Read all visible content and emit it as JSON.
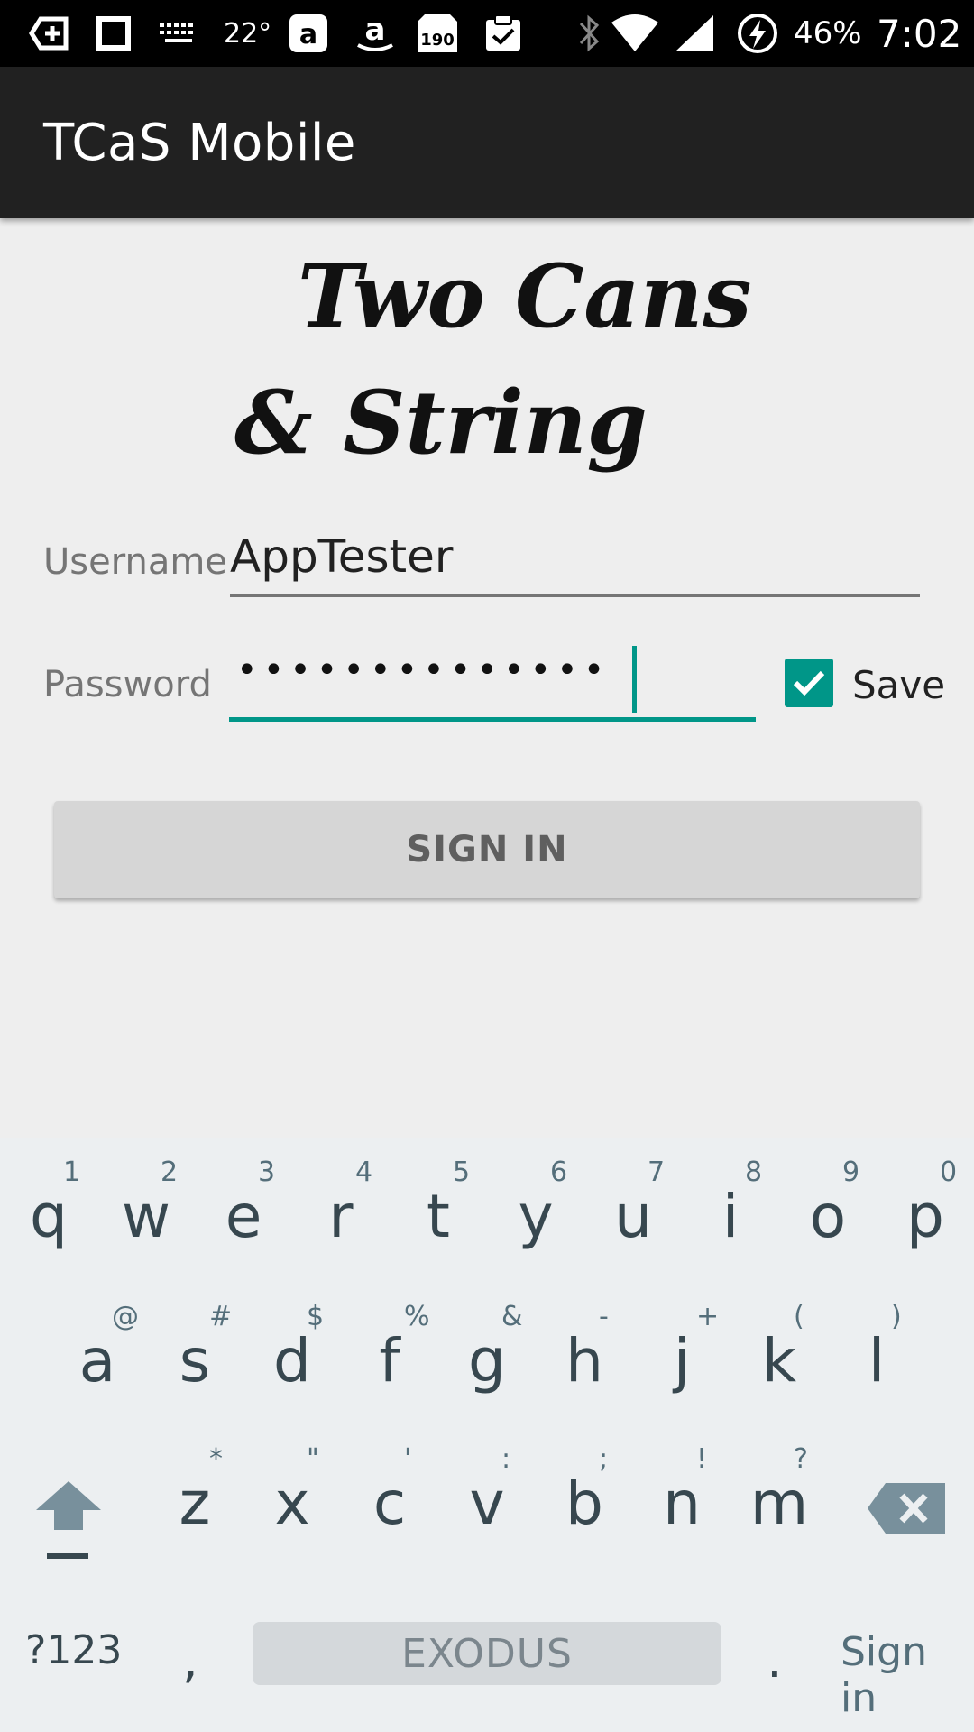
{
  "status_bar": {
    "temperature": "22°",
    "badge_count": "190",
    "battery_percent": "46%",
    "time": "7:02",
    "icons": [
      "add-box-icon",
      "square-icon",
      "keyboard-icon",
      "amazon-a-icon",
      "amazon-smile-icon",
      "mail-badge-icon",
      "clipboard-check-icon",
      "bluetooth-icon",
      "wifi-icon",
      "signal-icon",
      "battery-charging-icon"
    ]
  },
  "app_bar": {
    "title": "TCaS Mobile"
  },
  "logo": {
    "line1": "Two Cans",
    "line2": "& String"
  },
  "form": {
    "username_label": "Username",
    "username_value": "AppTester",
    "password_label": "Password",
    "password_mask": "••••••••••••••",
    "save_label": "Save",
    "save_checked": true,
    "signin_label": "SIGN IN"
  },
  "colors": {
    "accent": "#009688",
    "app_bar": "#212121",
    "background": "#eeeeee"
  },
  "keyboard": {
    "row1": [
      {
        "key": "q",
        "hint": "1"
      },
      {
        "key": "w",
        "hint": "2"
      },
      {
        "key": "e",
        "hint": "3"
      },
      {
        "key": "r",
        "hint": "4"
      },
      {
        "key": "t",
        "hint": "5"
      },
      {
        "key": "y",
        "hint": "6"
      },
      {
        "key": "u",
        "hint": "7"
      },
      {
        "key": "i",
        "hint": "8"
      },
      {
        "key": "o",
        "hint": "9"
      },
      {
        "key": "p",
        "hint": "0"
      }
    ],
    "row2": [
      {
        "key": "a",
        "hint": "@"
      },
      {
        "key": "s",
        "hint": "#"
      },
      {
        "key": "d",
        "hint": "$"
      },
      {
        "key": "f",
        "hint": "%"
      },
      {
        "key": "g",
        "hint": "&"
      },
      {
        "key": "h",
        "hint": "-"
      },
      {
        "key": "j",
        "hint": "+"
      },
      {
        "key": "k",
        "hint": "("
      },
      {
        "key": "l",
        "hint": ")"
      }
    ],
    "row3": [
      {
        "key": "z",
        "hint": "*"
      },
      {
        "key": "x",
        "hint": "\""
      },
      {
        "key": "c",
        "hint": "'"
      },
      {
        "key": "v",
        "hint": ":"
      },
      {
        "key": "b",
        "hint": ";"
      },
      {
        "key": "n",
        "hint": "!"
      },
      {
        "key": "m",
        "hint": "?"
      }
    ],
    "symbols_label": "?123",
    "comma": ",",
    "space_label": "EXODUS",
    "period": ".",
    "action_label": "Sign in"
  }
}
